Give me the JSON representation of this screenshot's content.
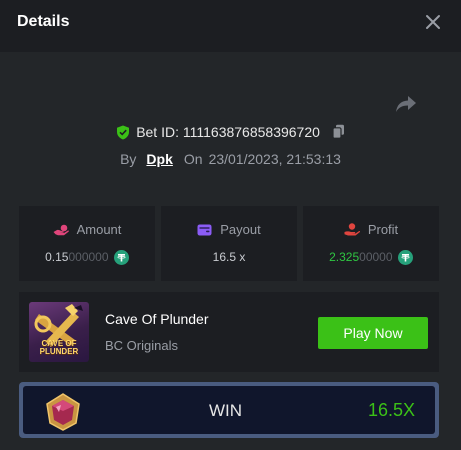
{
  "header": {
    "title": "Details"
  },
  "bet": {
    "id_label": "Bet ID:",
    "id": "111163876858396720",
    "by_label": "By",
    "user": "Dpk",
    "on_label": "On",
    "datetime": "23/01/2023, 21:53:13"
  },
  "stats": {
    "amount": {
      "label": "Amount",
      "value_main": "0.15",
      "value_dim": "000000"
    },
    "payout": {
      "label": "Payout",
      "value": "16.5 x"
    },
    "profit": {
      "label": "Profit",
      "value_main": "2.325",
      "value_dim": "00000"
    }
  },
  "game": {
    "name": "Cave Of Plunder",
    "provider": "BC Originals",
    "thumb_text_line1": "CAVE OF",
    "thumb_text_line2": "PLUNDER",
    "play_label": "Play Now"
  },
  "result": {
    "label": "WIN",
    "multiplier": "16.5X"
  },
  "colors": {
    "accent_green": "#3bc117",
    "profit_green": "#2fc742",
    "amount_icon": "#e0457b",
    "payout_icon": "#8b5cf6",
    "profit_icon": "#e0453f",
    "coin": "#26a17b"
  },
  "icons": {
    "close": "close-icon",
    "share": "share-icon",
    "verified": "shield-check-icon",
    "copy": "copy-icon",
    "amount": "hand-coin-icon",
    "payout": "wallet-icon",
    "profit": "profit-hand-icon",
    "currency": "usdt-coin-icon",
    "gem": "gem-icon"
  }
}
